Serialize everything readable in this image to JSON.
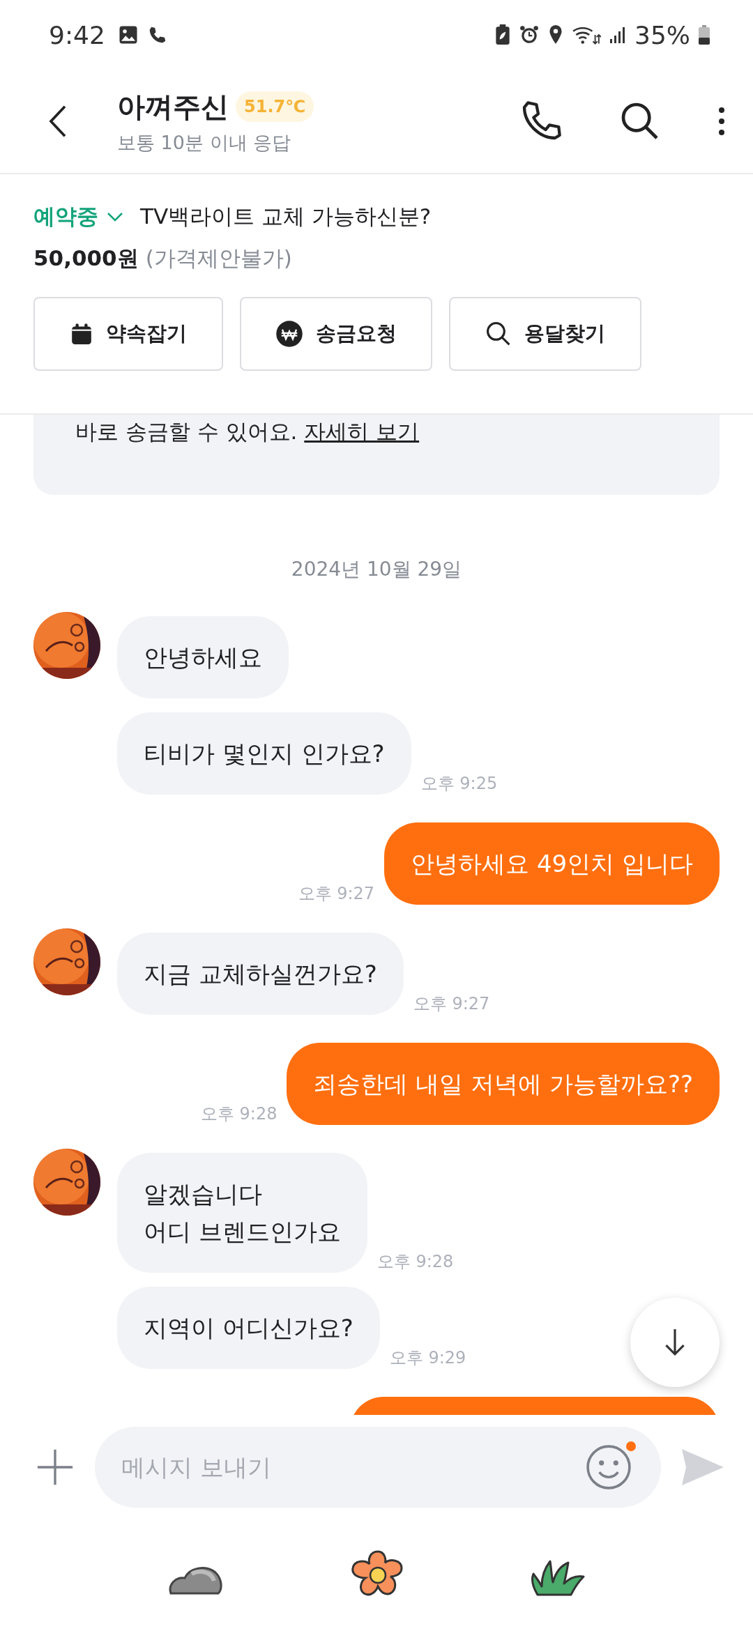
{
  "status_bar": {
    "time": "9:42",
    "battery": "35%"
  },
  "header": {
    "title": "아껴주신",
    "temperature": "51.7℃",
    "subtitle": "보통 10분 이내 응답"
  },
  "product": {
    "status": "예약중",
    "title": "TV백라이트 교체 가능하신분?",
    "price": "50,000원",
    "price_note": "(가격제안불가)"
  },
  "actions": [
    {
      "label": "약속잡기",
      "kind": "calendar"
    },
    {
      "label": "송금요청",
      "kind": "won"
    },
    {
      "label": "용달찾기",
      "kind": "search"
    }
  ],
  "notice": {
    "text": "바로 송금할 수 있어요.",
    "link": "자세히 보기"
  },
  "date": "2024년 10월 29일",
  "messages": [
    {
      "kind": "incoming",
      "avatar": true,
      "text": "안녕하세요"
    },
    {
      "kind": "incoming",
      "avatar": false,
      "text": "티비가 몇인지 인가요?",
      "time": "오후 9:25"
    },
    {
      "kind": "outgoing",
      "text": "안녕하세요 49인치 입니다",
      "time": "오후 9:27"
    },
    {
      "kind": "incoming",
      "avatar": true,
      "text": "지금 교체하실껀가요?",
      "time": "오후 9:27"
    },
    {
      "kind": "outgoing",
      "text": "죄송한데 내일 저녁에 가능할까요??",
      "time": "오후 9:28"
    },
    {
      "kind": "incoming",
      "avatar": true,
      "text": "알겠습니다\n어디 브렌드인가요",
      "time": "오후 9:28"
    },
    {
      "kind": "incoming",
      "avatar": false,
      "text": "지역이 어디신가요?",
      "time": "오후 9:29"
    },
    {
      "kind": "outgoing"
    }
  ],
  "composer": {
    "placeholder": "메시지 보내기",
    "emoji_badge": true
  }
}
